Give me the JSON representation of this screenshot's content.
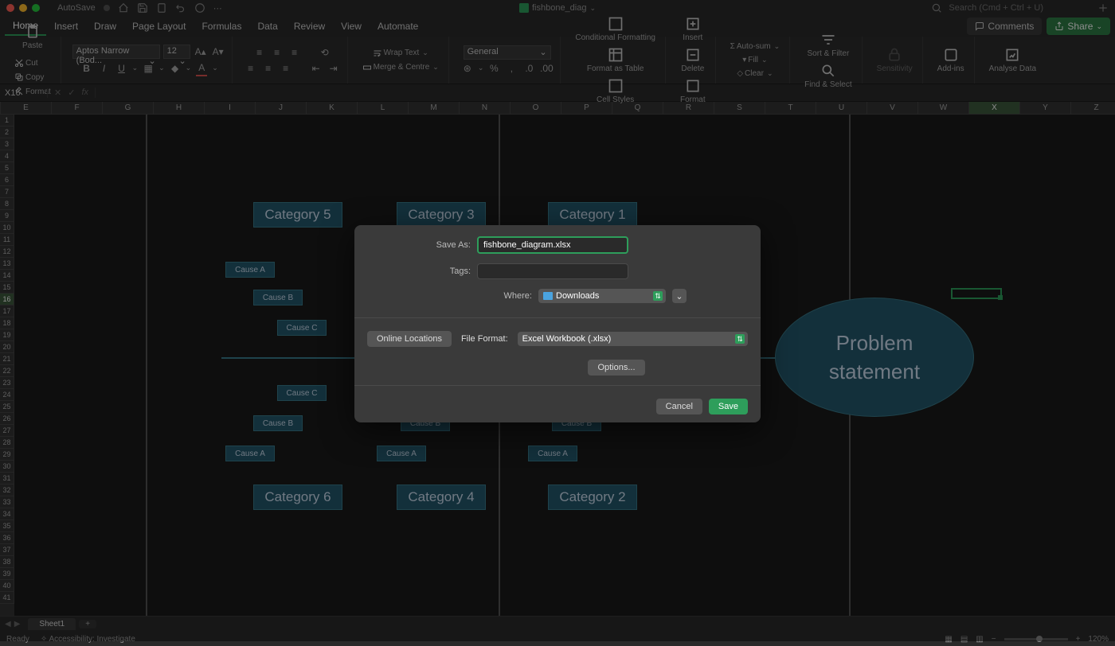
{
  "titlebar": {
    "autosave_label": "AutoSave",
    "filename": "fishbone_diag",
    "search_placeholder": "Search (Cmd + Ctrl + U)"
  },
  "menutabs": {
    "items": [
      "Home",
      "Insert",
      "Draw",
      "Page Layout",
      "Formulas",
      "Data",
      "Review",
      "View",
      "Automate"
    ],
    "active": 0,
    "comments_label": "Comments",
    "share_label": "Share"
  },
  "ribbon": {
    "paste_label": "Paste",
    "cut_label": "Cut",
    "copy_label": "Copy",
    "format_label": "Format",
    "font_name": "Aptos Narrow (Bod...",
    "font_size": "12",
    "wrap_label": "Wrap Text",
    "merge_label": "Merge & Centre",
    "number_format": "General",
    "cond_fmt_label": "Conditional Formatting",
    "fmt_table_label": "Format as Table",
    "cell_styles_label": "Cell Styles",
    "insert_label": "Insert",
    "delete_label": "Delete",
    "format_cells_label": "Format",
    "autosum_label": "Auto-sum",
    "fill_label": "Fill",
    "clear_label": "Clear",
    "sort_label": "Sort & Filter",
    "find_label": "Find & Select",
    "sensitivity_label": "Sensitivity",
    "addins_label": "Add-ins",
    "analyse_label": "Analyse Data"
  },
  "formula": {
    "cell_ref": "X16"
  },
  "columns": [
    "E",
    "F",
    "G",
    "H",
    "I",
    "J",
    "K",
    "L",
    "M",
    "N",
    "O",
    "P",
    "Q",
    "R",
    "S",
    "T",
    "U",
    "V",
    "W",
    "X",
    "Y",
    "Z"
  ],
  "rows_start": 1,
  "rows_end": 41,
  "selected_row": 16,
  "selected_col": "X",
  "diagram": {
    "top_categories": [
      "Category 5",
      "Category 3",
      "Category 1"
    ],
    "bottom_categories": [
      "Category 6",
      "Category 4",
      "Category 2"
    ],
    "causes": [
      "Cause A",
      "Cause B",
      "Cause C"
    ],
    "problem_l1": "Problem",
    "problem_l2": "statement"
  },
  "sheet": {
    "tab1": "Sheet1"
  },
  "status": {
    "ready": "Ready",
    "accessibility": "Accessibility: Investigate",
    "zoom": "120%"
  },
  "dialog": {
    "save_as_label": "Save As:",
    "filename_value": "fishbone_diagram.xlsx",
    "tags_label": "Tags:",
    "where_label": "Where:",
    "where_value": "Downloads",
    "online_locations_label": "Online Locations",
    "file_format_label": "File Format:",
    "file_format_value": "Excel Workbook (.xlsx)",
    "options_label": "Options...",
    "cancel_label": "Cancel",
    "save_label": "Save"
  }
}
